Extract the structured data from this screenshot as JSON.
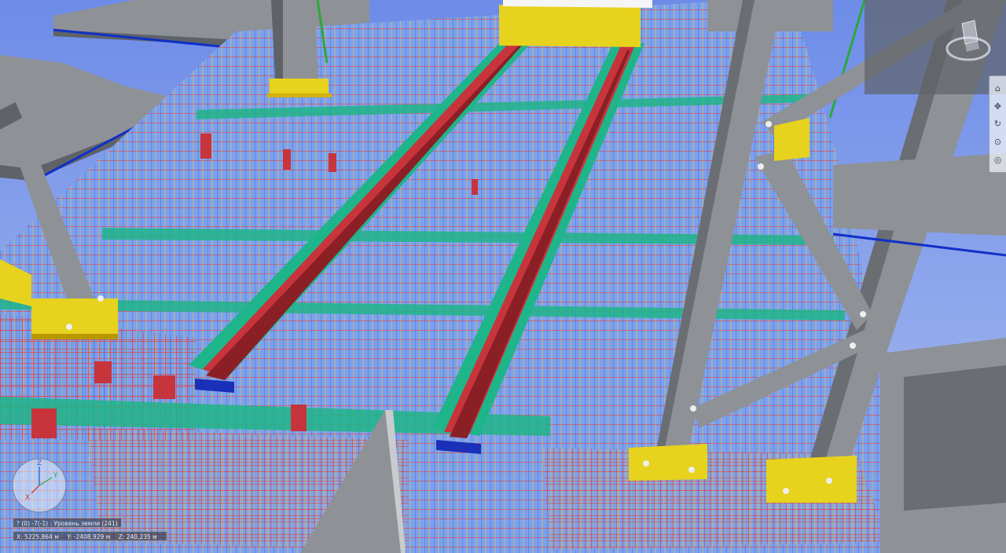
{
  "viewport": {
    "background_top": "#6d8ce8",
    "background_bottom": "#a9bbf0"
  },
  "colors": {
    "rebar_red": "#e0474f",
    "rebar_blue": "#2f7fd8",
    "rebar_yellow": "#e9d23a",
    "concrete_green": "#1fb58a",
    "steel_gray": "#8e9196",
    "steel_dark": "#5f6267",
    "beam_red": "#c8343c",
    "plate_yellow": "#e7d21d",
    "axis_line": "#1030c8"
  },
  "axis_gizmo": {
    "z_label": "Z",
    "y_label": "Y",
    "x_label": "X"
  },
  "navbar": {
    "items": [
      {
        "icon": "home-icon",
        "glyph": "⌂"
      },
      {
        "icon": "pan-icon",
        "glyph": "✥"
      },
      {
        "icon": "orbit-icon",
        "glyph": "↻"
      },
      {
        "icon": "zoom-icon",
        "glyph": "⊙"
      },
      {
        "icon": "walk-icon",
        "glyph": "◎"
      }
    ]
  },
  "status": {
    "level": "? (0) -7(-1) : Уровень земли (241)",
    "x": "X: 5225,864 м",
    "y": "Y: -2408,929 м",
    "z": "Z: 240,235 м"
  }
}
